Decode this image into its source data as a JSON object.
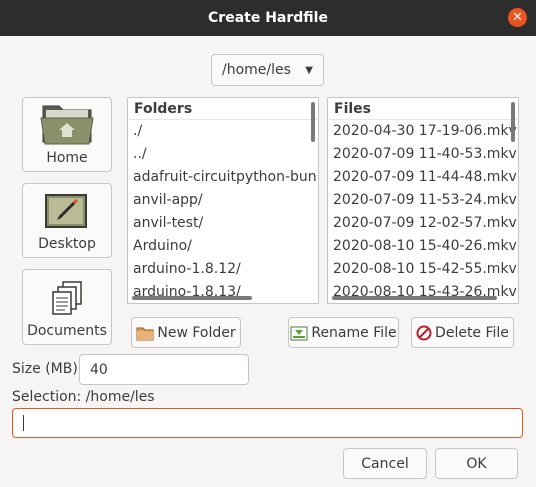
{
  "window": {
    "title": "Create Hardfile",
    "close_glyph": "✕"
  },
  "path_combo": {
    "value": "/home/les",
    "arrow": "▼"
  },
  "places": [
    {
      "label": "Home",
      "icon": "home-folder-icon"
    },
    {
      "label": "Desktop",
      "icon": "desktop-icon"
    },
    {
      "label": "Documents",
      "icon": "documents-icon"
    }
  ],
  "folders": {
    "header": "Folders",
    "items": [
      "./",
      "../",
      "adafruit-circuitpython-bun",
      "anvil-app/",
      "anvil-test/",
      "Arduino/",
      "arduino-1.8.12/",
      "arduino-1.8.13/"
    ]
  },
  "files": {
    "header": "Files",
    "items": [
      "2020-04-30 17-19-06.mkv",
      "2020-07-09 11-40-53.mkv",
      "2020-07-09 11-44-48.mkv",
      "2020-07-09 11-53-24.mkv",
      "2020-07-09 12-02-57.mkv",
      "2020-08-10 15-40-26.mkv",
      "2020-08-10 15-42-55.mkv",
      "2020-08-10 15-43-26.mkv"
    ]
  },
  "buttons": {
    "new_folder": "New Folder",
    "rename_file": "Rename File",
    "delete_file": "Delete File",
    "cancel": "Cancel",
    "ok": "OK"
  },
  "size": {
    "label": "Size (MB)",
    "value": "40"
  },
  "selection": {
    "label": "Selection: /home/les",
    "value": ""
  },
  "colors": {
    "titlebar": "#2d2d2d",
    "close": "#e95420",
    "focus_border": "#e95420"
  }
}
